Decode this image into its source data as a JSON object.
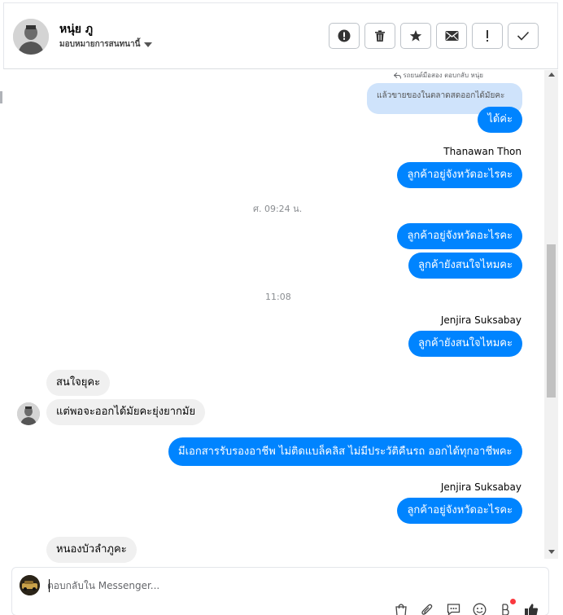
{
  "header": {
    "contact_name": "หนุ่ย ภู",
    "assign_label": "มอบหมายการสนทนานี้",
    "actions": [
      {
        "name": "spam-button",
        "icon": "alert-circle-icon"
      },
      {
        "name": "delete-button",
        "icon": "trash-icon"
      },
      {
        "name": "star-button",
        "icon": "star-icon"
      },
      {
        "name": "unread-button",
        "icon": "envelope-icon"
      },
      {
        "name": "follow-up-button",
        "icon": "exclamation-icon"
      },
      {
        "name": "done-button",
        "icon": "checkmark-icon"
      }
    ]
  },
  "thread": {
    "reply_note": "รถยนต์มือสอง ตอบกลับ หนุ่ย",
    "quoted_text": "แล้วขายของในตลาดสดออกได้มัยคะ",
    "messages": [
      {
        "text": "ได้ค่ะ"
      },
      {
        "sender": "Thanawan Thon"
      },
      {
        "text": "ลูกค้าอยู่จังหวัดอะไรคะ"
      },
      {
        "timestamp": "ศ. 09:24 น."
      },
      {
        "text": "ลูกค้าอยู่จังหวัดอะไรคะ"
      },
      {
        "text": "ลูกค้ายังสนใจไหมคะ"
      },
      {
        "timestamp": "11:08"
      },
      {
        "sender": "Jenjira Suksabay"
      },
      {
        "text": "ลูกค้ายังสนใจไหมคะ"
      },
      {
        "text": "สนใจยุคะ"
      },
      {
        "text": "แต่พอจะออกได้มัยคะยุ่งยากมัย"
      },
      {
        "text": "มีเอกสารรับรองอาชีพ ไม่ติดแบล็คลิส ไม่มีประวัติคืนรถ ออกได้ทุกอาชีพคะ"
      },
      {
        "sender": "Jenjira Suksabay"
      },
      {
        "text": "ลูกค้าอยู่จังหวัดอะไรคะ"
      },
      {
        "text": "หนองบัวลำภูคะ"
      }
    ]
  },
  "composer": {
    "placeholder": "ตอบกลับใน Messenger...",
    "tools": [
      "bag-icon",
      "paperclip-icon",
      "saved-reply-icon",
      "emoji-icon",
      "bot-icon",
      "thumbs-up-icon"
    ]
  },
  "colors": {
    "outgoing": "#0084ff",
    "incoming": "#f0f0f0",
    "quoted": "#cfe3fb"
  }
}
